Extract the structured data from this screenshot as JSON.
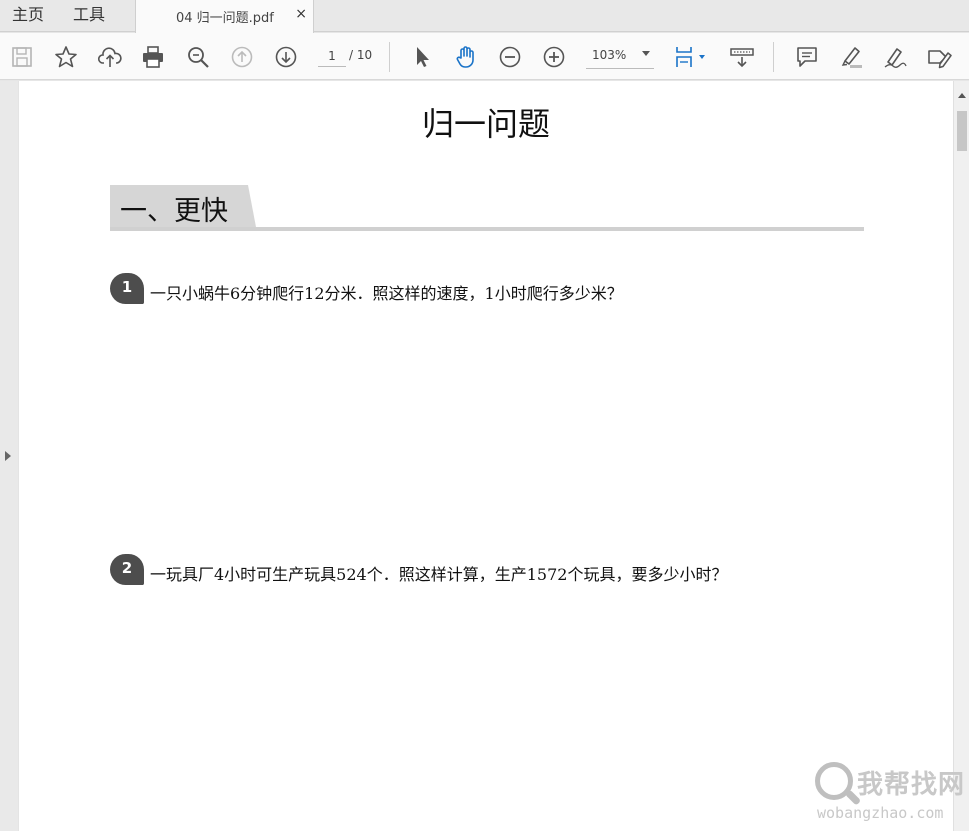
{
  "tabbar": {
    "home_label": "主页",
    "tools_label": "工具",
    "document_tab": "04 归一问题.pdf",
    "close_glyph": "×"
  },
  "toolbar": {
    "icons": [
      "save-icon",
      "bookmark-star-icon",
      "upload-cloud-icon",
      "print-icon",
      "search-zoom-icon",
      "page-up-icon",
      "page-down-icon",
      "select-cursor-icon",
      "hand-tool-icon",
      "zoom-out-icon",
      "zoom-in-icon",
      "fit-page-icon",
      "scroll-mode-icon",
      "comment-icon",
      "highlight-icon",
      "sign-icon",
      "edit-icon"
    ],
    "page_current": "1",
    "page_total": "/ 10",
    "zoom": "103%",
    "accent_color": "#1a73c8"
  },
  "document": {
    "title": "归一问题",
    "section_title": "一、更快",
    "questions": [
      {
        "number": "1",
        "text": "一只小蜗牛6分钟爬行12分米．照这样的速度，1小时爬行多少米？"
      },
      {
        "number": "2",
        "text": "一玩具厂4小时可生产玩具524个．照这样计算，生产1572个玩具，要多少小时？"
      }
    ]
  },
  "watermark": {
    "cn": "我帮找网",
    "en": "wobangzhao.com"
  }
}
